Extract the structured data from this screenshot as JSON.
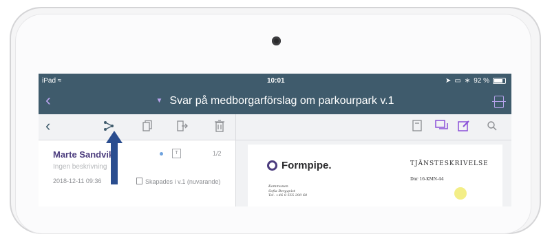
{
  "status_bar": {
    "device": "iPad",
    "time": "10:01",
    "battery": "92 %"
  },
  "nav": {
    "title": "Svar på medborgarförslag om parkourpark",
    "version": "v.1"
  },
  "list_item": {
    "name": "Marte Sandvik",
    "description": "Ingen beskrivning",
    "date": "2018-12-11 09:36",
    "page": "1/2",
    "version_info": "Skapades i v.1 (nuvarande)"
  },
  "document": {
    "brand": "Formpipe.",
    "type": "TJÄNSTESKRIVELSE",
    "number": "Dnr 16-KMN-44",
    "meta_lines": [
      "Kommunen",
      "Sofia Bergqvist",
      "Tel. +46 8 555 290 60"
    ]
  },
  "colors": {
    "bar": "#3f5b6c",
    "accent": "#b7a3ec",
    "purple": "#4c3d7e",
    "arrow": "#2a4d8f"
  }
}
